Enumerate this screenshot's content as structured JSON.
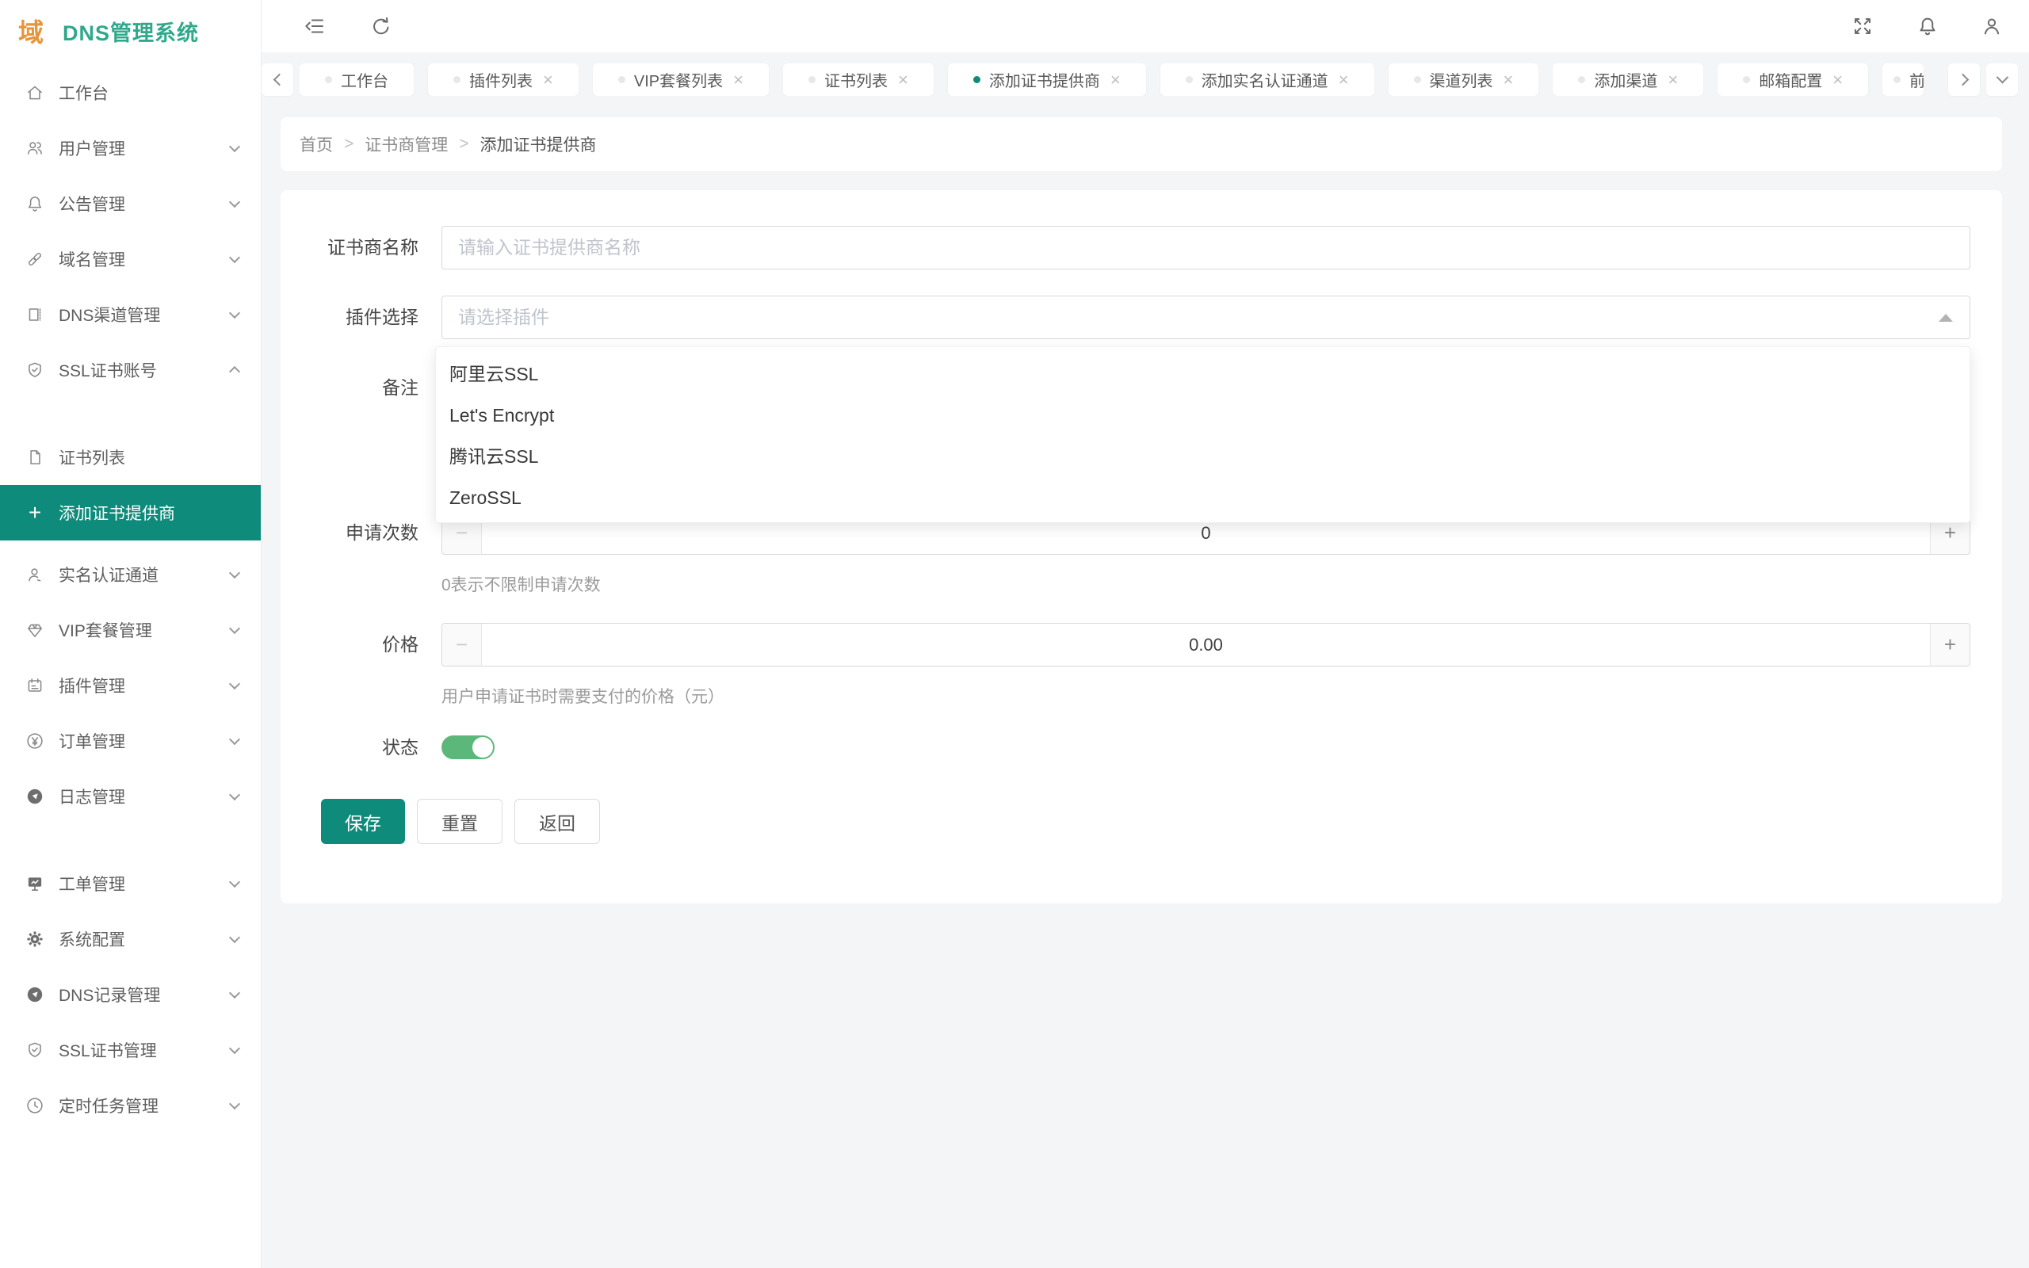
{
  "app": {
    "logo_mark": "域",
    "title": "DNS管理系统"
  },
  "colors": {
    "brand_teal": "#0e8b7a",
    "logo_orange": "#e6953a",
    "logo_teal": "#2fa98c",
    "toggle_green": "#5cb87a"
  },
  "sidebar": {
    "items": [
      {
        "label": "工作台"
      },
      {
        "label": "用户管理"
      },
      {
        "label": "公告管理"
      },
      {
        "label": "域名管理"
      },
      {
        "label": "DNS渠道管理"
      },
      {
        "label": "SSL证书账号"
      },
      {
        "label": "证书列表"
      },
      {
        "label": "添加证书提供商"
      },
      {
        "label": "实名认证通道"
      },
      {
        "label": "VIP套餐管理"
      },
      {
        "label": "插件管理"
      },
      {
        "label": "订单管理"
      },
      {
        "label": "日志管理"
      },
      {
        "label": "工单管理"
      },
      {
        "label": "系统配置"
      },
      {
        "label": "DNS记录管理"
      },
      {
        "label": "SSL证书管理"
      },
      {
        "label": "定时任务管理"
      }
    ],
    "active_item": "添加证书提供商",
    "plus_glyph": "+"
  },
  "tabs": {
    "close_glyph": "×",
    "items": [
      {
        "label": "工作台"
      },
      {
        "label": "插件列表"
      },
      {
        "label": "VIP套餐列表"
      },
      {
        "label": "证书列表"
      },
      {
        "label": "添加证书提供商"
      },
      {
        "label": "添加实名认证通道"
      },
      {
        "label": "渠道列表"
      },
      {
        "label": "添加渠道"
      },
      {
        "label": "邮箱配置"
      },
      {
        "label": "前"
      }
    ],
    "active_tab": "添加证书提供商"
  },
  "breadcrumb": {
    "separator": ">",
    "items": [
      "首页",
      "证书商管理",
      "添加证书提供商"
    ]
  },
  "form": {
    "name": {
      "label": "证书商名称",
      "placeholder": "请输入证书提供商名称",
      "value": ""
    },
    "plugin": {
      "label": "插件选择",
      "placeholder": "请选择插件",
      "options": [
        "阿里云SSL",
        "Let's Encrypt",
        "腾讯云SSL",
        "ZeroSSL"
      ]
    },
    "remark": {
      "label": "备注"
    },
    "stepper": {
      "minus": "−",
      "plus": "+"
    },
    "apply_count": {
      "label": "申请次数",
      "value": "0",
      "hint": "0表示不限制申请次数"
    },
    "price": {
      "label": "价格",
      "value": "0.00",
      "hint": "用户申请证书时需要支付的价格（元）"
    },
    "status": {
      "label": "状态",
      "on": true
    },
    "buttons": {
      "save": "保存",
      "reset": "重置",
      "back": "返回"
    }
  }
}
